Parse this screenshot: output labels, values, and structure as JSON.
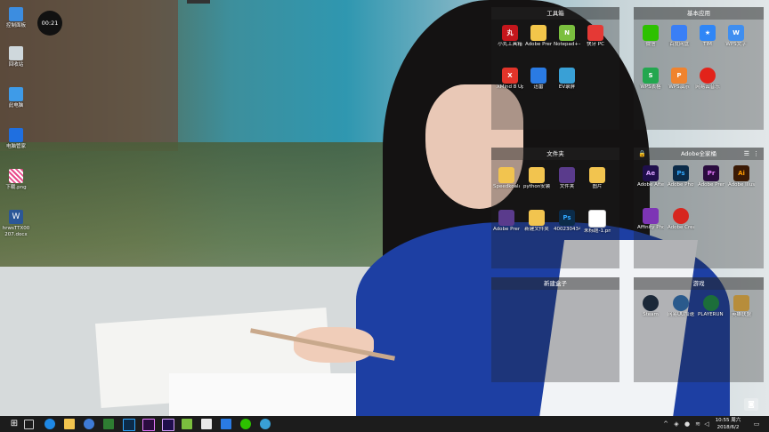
{
  "desktop": {
    "clock_widget": "00:21",
    "icons": [
      {
        "label": "控制面板"
      },
      {
        "label": "回收站"
      },
      {
        "label": "此电脑"
      },
      {
        "label": "电脑管家"
      },
      {
        "label": "下载.png"
      },
      {
        "label": "hrwsTTX00 207.docx"
      }
    ]
  },
  "fences": {
    "tools": {
      "title": "工具箱",
      "items": [
        {
          "label": "小丸工具箱",
          "icon": "丸",
          "color": "#c4161c"
        },
        {
          "label": "Adobe Premier...",
          "icon": "",
          "color": "#f3c64a"
        },
        {
          "label": "Notepad++",
          "icon": "N",
          "color": "#7bbf3e"
        },
        {
          "label": "快牙 PC",
          "icon": "",
          "color": "#e53935"
        },
        {
          "label": "XMind 8 Update 7",
          "icon": "X",
          "color": "#e2342a"
        },
        {
          "label": "迅雷",
          "icon": "",
          "color": "#2a7be4"
        },
        {
          "label": "EV录屏",
          "icon": "",
          "color": "#39a0d6"
        }
      ]
    },
    "basic": {
      "title": "基本应用",
      "items": [
        {
          "label": "微信",
          "icon": "",
          "color": "#2dc100"
        },
        {
          "label": "百度网盘",
          "icon": "",
          "color": "#3a7ff6"
        },
        {
          "label": "TIM",
          "icon": "★",
          "color": "#2f86f6"
        },
        {
          "label": "WPS文字",
          "icon": "W",
          "color": "#3f8ef0"
        },
        {
          "label": "WPS表格",
          "icon": "S",
          "color": "#23a74f"
        },
        {
          "label": "WPS演示",
          "icon": "P",
          "color": "#f0832e"
        },
        {
          "label": "网易云音乐",
          "icon": "",
          "color": "#e2231a"
        }
      ]
    },
    "folders": {
      "title": "文件夹",
      "items": [
        {
          "label": "Speedkoala FPS优化...",
          "icon": "",
          "color": "#f2c44f"
        },
        {
          "label": "python安装包",
          "icon": "",
          "color": "#f2c44f"
        },
        {
          "label": "文件夹",
          "icon": "",
          "color": "#5a3b8c"
        },
        {
          "label": "图片",
          "icon": "",
          "color": "#f2c44f"
        },
        {
          "label": "Adobe Premier...",
          "icon": "",
          "color": "#5a3b8c"
        },
        {
          "label": "新建文件夹",
          "icon": "",
          "color": "#f2c44f"
        },
        {
          "label": "400230434 552187B...",
          "icon": "Ps",
          "color": "#0b2b49"
        },
        {
          "label": "未标题-1.png",
          "icon": "",
          "color": "#ffffff"
        }
      ]
    },
    "adobe": {
      "title": "Adobe全家桶",
      "items": [
        {
          "label": "Adobe After Ef...",
          "icon": "Ae",
          "color": "#1f0f4c"
        },
        {
          "label": "Adobe Photosh...",
          "icon": "Ps",
          "color": "#0b2b49"
        },
        {
          "label": "Adobe Premiere...",
          "icon": "Pr",
          "color": "#2b0c3f"
        },
        {
          "label": "Adobe Illustrat...",
          "icon": "Ai",
          "color": "#3b1a05"
        },
        {
          "label": "Affinity Photo",
          "icon": "",
          "color": "#7d35b5"
        },
        {
          "label": "Adobe Creati...",
          "icon": "",
          "color": "#d7261f"
        }
      ]
    },
    "newbox": {
      "title": "新建盒子",
      "items": []
    },
    "games": {
      "title": "游戏",
      "items": [
        {
          "label": "Steam",
          "icon": "",
          "color": "#1b2838"
        },
        {
          "label": "网易UU加速器",
          "icon": "",
          "color": "#2a5a8c"
        },
        {
          "label": "PLAYERUN KNOWN'...",
          "icon": "",
          "color": "#1c6e3a"
        },
        {
          "label": "英雄联盟",
          "icon": "",
          "color": "#b78d3b"
        }
      ]
    }
  },
  "taskbar": {
    "time": "10:55 周六",
    "date": "2018/6/2"
  }
}
